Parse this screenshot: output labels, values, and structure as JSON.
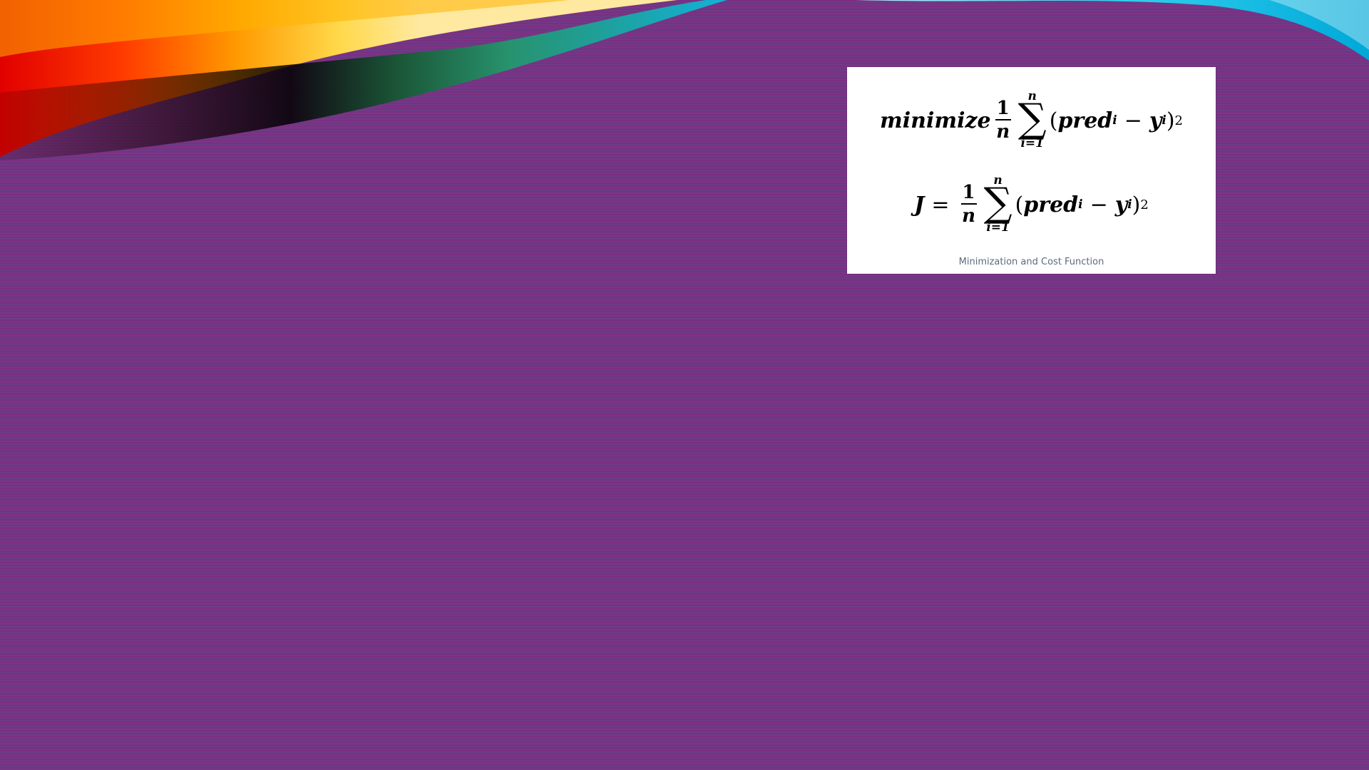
{
  "slide": {
    "background_color": "#7a2e80",
    "swoosh_colors": [
      "#ff0000",
      "#ff8a00",
      "#ffd400",
      "#1f8f3a",
      "#00c8e6",
      "#000000"
    ]
  },
  "equation_card": {
    "equation_1": {
      "prefix": "minimize",
      "fraction_numerator": "1",
      "fraction_denominator": "n",
      "sum_upper": "n",
      "sum_symbol": "∑",
      "sum_lower": "i=1",
      "open_paren": "(",
      "term_a": "pred",
      "term_a_sub": "i",
      "minus": "−",
      "term_b": "y",
      "term_b_sub": "i",
      "close_paren": ")",
      "exponent": "2"
    },
    "equation_2": {
      "lhs": "J",
      "equals": "=",
      "fraction_numerator": "1",
      "fraction_denominator": "n",
      "sum_upper": "n",
      "sum_symbol": "∑",
      "sum_lower": "i=1",
      "open_paren": "(",
      "term_a": "pred",
      "term_a_sub": "i",
      "minus": "−",
      "term_b": "y",
      "term_b_sub": "i",
      "close_paren": ")",
      "exponent": "2"
    },
    "caption": "Minimization and Cost Function"
  }
}
